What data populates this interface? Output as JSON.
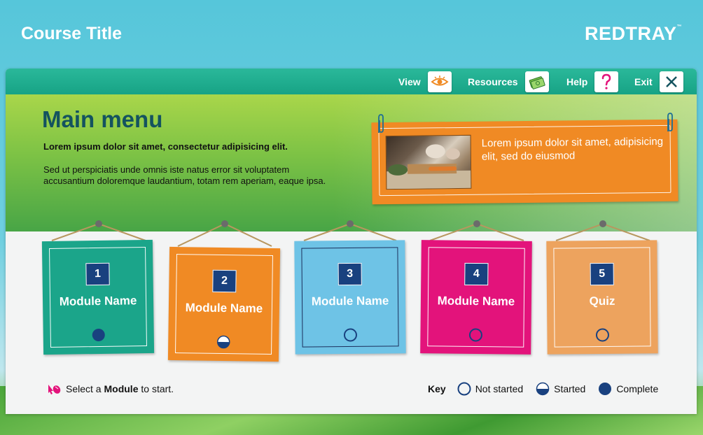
{
  "header": {
    "course_title": "Course Title",
    "brand": "REDTRAY",
    "brand_tm": "™"
  },
  "toolbar": [
    {
      "label": "View",
      "icon": "eye-icon"
    },
    {
      "label": "Resources",
      "icon": "money-icon"
    },
    {
      "label": "Help",
      "icon": "question-icon"
    },
    {
      "label": "Exit",
      "icon": "close-icon"
    }
  ],
  "hero": {
    "title": "Main menu",
    "lead": "Lorem ipsum dolor sit amet, consectetur adipisicing elit.",
    "body": "Sed ut perspiciatis unde omnis iste natus error sit voluptatem accusantium doloremque laudantium, totam rem aperiam, eaque ipsa.",
    "note_text": "Lorem ipsum dolor sit amet, adipisicing elit, sed do eiusmod"
  },
  "modules": [
    {
      "number": "1",
      "name": "Module Name",
      "status": "complete",
      "color": "#1ba58a"
    },
    {
      "number": "2",
      "name": "Module Name",
      "status": "started",
      "color": "#f08a24"
    },
    {
      "number": "3",
      "name": "Module Name",
      "status": "not-started",
      "color": "#6ec3e6"
    },
    {
      "number": "4",
      "name": "Module Name",
      "status": "not-started",
      "color": "#e3137b"
    },
    {
      "number": "5",
      "name": "Quiz",
      "status": "not-started",
      "color": "#eda35e"
    }
  ],
  "footer": {
    "hint_prefix": "Select a",
    "hint_bold": "Module",
    "hint_suffix": "to start.",
    "key_title": "Key",
    "key_not_started": "Not started",
    "key_started": "Started",
    "key_complete": "Complete"
  },
  "colors": {
    "navy": "#19417f",
    "teal": "#17a385",
    "orange": "#f08a24"
  }
}
